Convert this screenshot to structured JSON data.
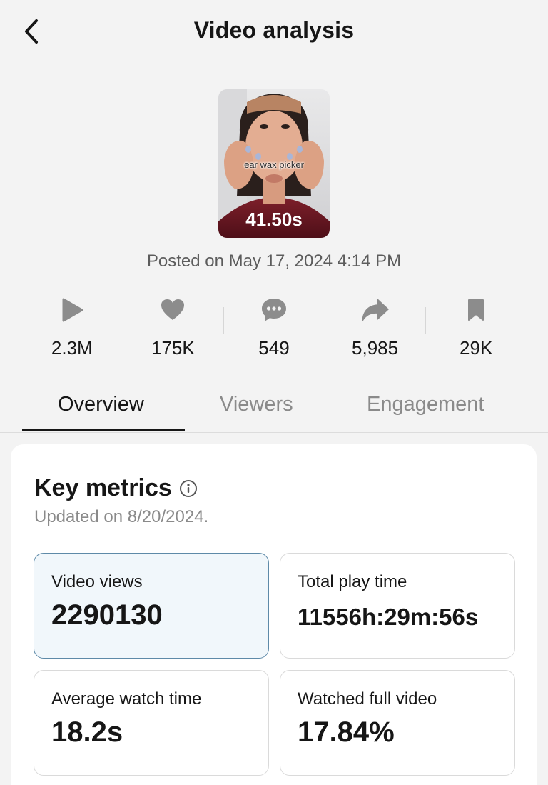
{
  "header": {
    "title": "Video analysis"
  },
  "video": {
    "caption": "ear wax picker",
    "duration": "41.50s",
    "posted": "Posted on May 17, 2024 4:14 PM"
  },
  "stats": [
    {
      "icon": "play-icon",
      "value": "2.3M"
    },
    {
      "icon": "heart-icon",
      "value": "175K"
    },
    {
      "icon": "comment-icon",
      "value": "549"
    },
    {
      "icon": "share-icon",
      "value": "5,985"
    },
    {
      "icon": "bookmark-icon",
      "value": "29K"
    }
  ],
  "tabs": [
    {
      "label": "Overview",
      "active": true
    },
    {
      "label": "Viewers",
      "active": false
    },
    {
      "label": "Engagement",
      "active": false
    }
  ],
  "key_metrics": {
    "title": "Key metrics",
    "updated": "Updated on 8/20/2024.",
    "cards": [
      {
        "label": "Video views",
        "value": "2290130",
        "selected": true
      },
      {
        "label": "Total play time",
        "value": "11556h:29m:56s",
        "selected": false
      },
      {
        "label": "Average watch time",
        "value": "18.2s",
        "selected": false
      },
      {
        "label": "Watched full video",
        "value": "17.84%",
        "selected": false
      }
    ]
  },
  "colors": {
    "background": "#f3f3f3",
    "card": "#ffffff",
    "selected_card_bg": "#f1f7fb",
    "selected_card_border": "#5e8aa8",
    "muted_text": "#8a8a8a",
    "icon_gray": "#8c8c8c"
  }
}
